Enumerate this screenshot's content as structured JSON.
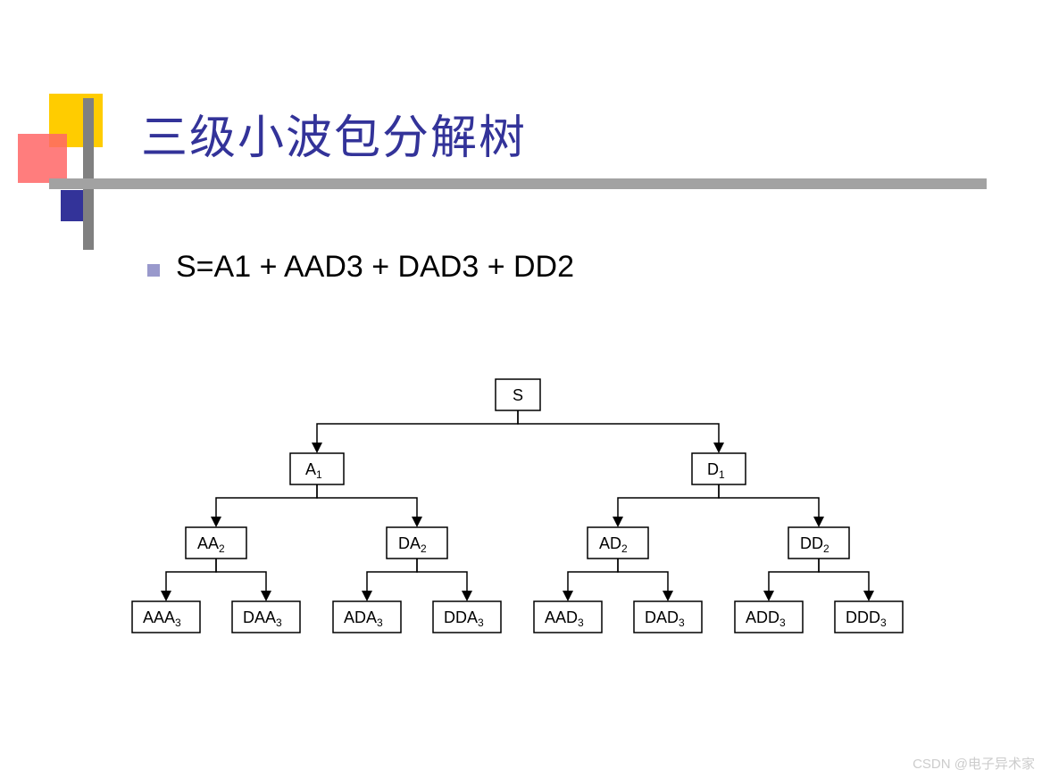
{
  "title": "三级小波包分解树",
  "formula": "S=A1 + AAD3 + DAD3 + DD2",
  "tree": {
    "root": {
      "label": "S",
      "sub": ""
    },
    "level1": [
      {
        "label": "A",
        "sub": "1"
      },
      {
        "label": "D",
        "sub": "1"
      }
    ],
    "level2": [
      {
        "label": "AA",
        "sub": "2"
      },
      {
        "label": "DA",
        "sub": "2"
      },
      {
        "label": "AD",
        "sub": "2"
      },
      {
        "label": "DD",
        "sub": "2"
      }
    ],
    "level3": [
      {
        "label": "AAA",
        "sub": "3"
      },
      {
        "label": "DAA",
        "sub": "3"
      },
      {
        "label": "ADA",
        "sub": "3"
      },
      {
        "label": "DDA",
        "sub": "3"
      },
      {
        "label": "AAD",
        "sub": "3"
      },
      {
        "label": "DAD",
        "sub": "3"
      },
      {
        "label": "ADD",
        "sub": "3"
      },
      {
        "label": "DDD",
        "sub": "3"
      }
    ]
  },
  "watermark": "CSDN @电子异术家"
}
